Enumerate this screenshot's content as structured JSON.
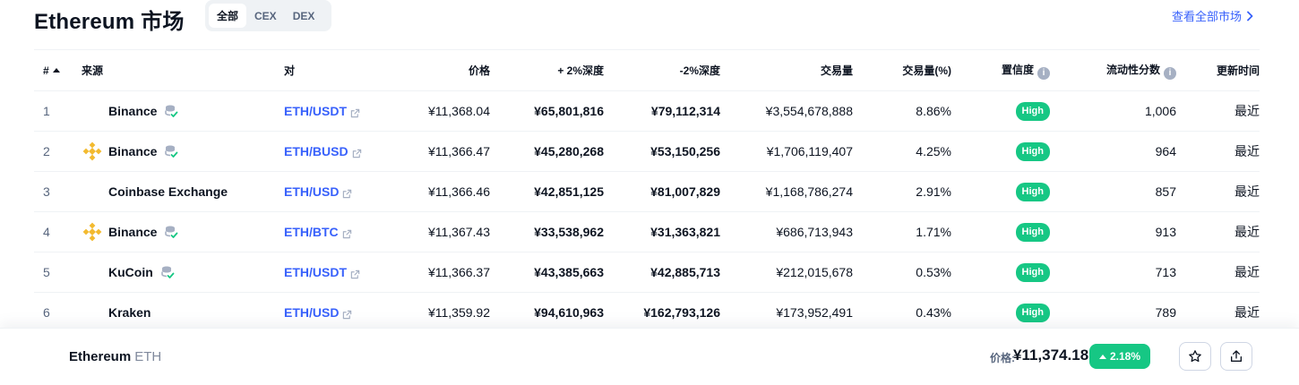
{
  "header": {
    "title": "Ethereum 市场",
    "tabs": [
      {
        "label": "全部",
        "active": true
      },
      {
        "label": "CEX",
        "active": false
      },
      {
        "label": "DEX",
        "active": false
      }
    ],
    "view_all": "查看全部市场"
  },
  "columns": {
    "rank": "#",
    "source": "来源",
    "pair": "对",
    "price": "价格",
    "depth_plus": "+ 2%深度",
    "depth_minus": "-2%深度",
    "volume": "交易量",
    "volume_pct": "交易量(%)",
    "confidence": "置信度",
    "liquidity": "流动性分数",
    "updated": "更新时间"
  },
  "rows": [
    {
      "rank": "1",
      "source": "Binance",
      "logo": "none",
      "db_icon": true,
      "pair": "ETH/USDT",
      "price": "¥11,368.04",
      "depth_plus": "¥65,801,816",
      "depth_minus": "¥79,112,314",
      "volume": "¥3,554,678,888",
      "volume_pct": "8.86%",
      "confidence": "High",
      "liquidity": "1,006",
      "updated": "最近"
    },
    {
      "rank": "2",
      "source": "Binance",
      "logo": "binance",
      "db_icon": true,
      "pair": "ETH/BUSD",
      "price": "¥11,366.47",
      "depth_plus": "¥45,280,268",
      "depth_minus": "¥53,150,256",
      "volume": "¥1,706,119,407",
      "volume_pct": "4.25%",
      "confidence": "High",
      "liquidity": "964",
      "updated": "最近"
    },
    {
      "rank": "3",
      "source": "Coinbase Exchange",
      "logo": "none",
      "db_icon": false,
      "pair": "ETH/USD",
      "price": "¥11,366.46",
      "depth_plus": "¥42,851,125",
      "depth_minus": "¥81,007,829",
      "volume": "¥1,168,786,274",
      "volume_pct": "2.91%",
      "confidence": "High",
      "liquidity": "857",
      "updated": "最近"
    },
    {
      "rank": "4",
      "source": "Binance",
      "logo": "binance",
      "db_icon": true,
      "pair": "ETH/BTC",
      "price": "¥11,367.43",
      "depth_plus": "¥33,538,962",
      "depth_minus": "¥31,363,821",
      "volume": "¥686,713,943",
      "volume_pct": "1.71%",
      "confidence": "High",
      "liquidity": "913",
      "updated": "最近"
    },
    {
      "rank": "5",
      "source": "KuCoin",
      "logo": "none",
      "db_icon": true,
      "pair": "ETH/USDT",
      "price": "¥11,366.37",
      "depth_plus": "¥43,385,663",
      "depth_minus": "¥42,885,713",
      "volume": "¥212,015,678",
      "volume_pct": "0.53%",
      "confidence": "High",
      "liquidity": "713",
      "updated": "最近"
    },
    {
      "rank": "6",
      "source": "Kraken",
      "logo": "none",
      "db_icon": false,
      "pair": "ETH/USD",
      "price": "¥11,359.92",
      "depth_plus": "¥94,610,963",
      "depth_minus": "¥162,793,126",
      "volume": "¥173,952,491",
      "volume_pct": "0.43%",
      "confidence": "High",
      "liquidity": "789",
      "updated": "最近"
    }
  ],
  "bottom_bar": {
    "coin_name": "Ethereum",
    "coin_symbol": "ETH",
    "price_label": "价格:",
    "price": "¥11,374.18",
    "change": "2.18%",
    "change_color": "#16c784",
    "star_icon": "star-icon",
    "share_icon": "share-icon"
  },
  "colors": {
    "accent": "#3861fb",
    "positive": "#16c784",
    "binance": "#f3ba2f"
  }
}
